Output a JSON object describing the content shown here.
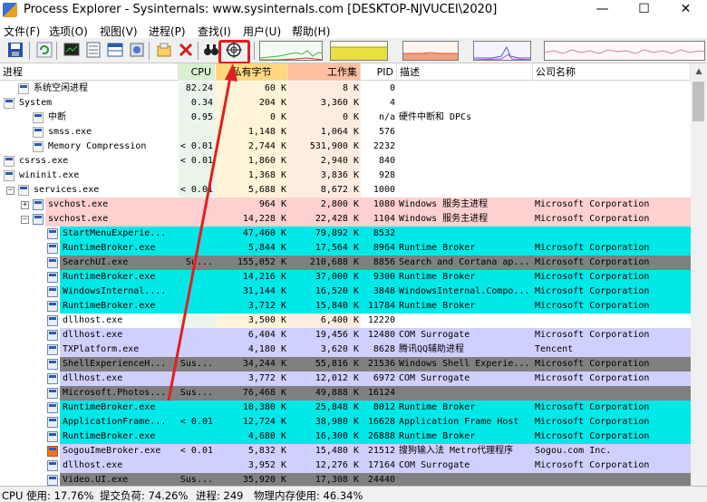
{
  "window": {
    "title": "Process Explorer - Sysinternals: www.sysinternals.com [DESKTOP-NJVUCEI\\2020]",
    "minimize_glyph": "—",
    "maximize_glyph": "☐",
    "close_glyph": "✕"
  },
  "menu": [
    "文件(F)",
    "选项(O)",
    "视图(V)",
    "进程(P)",
    "查找(I)",
    "用户(U)",
    "帮助(H)"
  ],
  "toolbar": {
    "icons": [
      "save-icon",
      "refresh-icon",
      "system-info-icon",
      "process-tree-icon",
      "lower-pane-icon",
      "handles-icon",
      "properties-icon",
      "kill-process-icon",
      "find-binoculars-icon",
      "target-crosshair-icon"
    ],
    "graph_colors": {
      "cpu": "#38b838",
      "commit": "#e8e020",
      "io": "#e05028",
      "net": "#4060e0",
      "mem": "#d8a0b0"
    }
  },
  "columns": {
    "process": "进程",
    "cpu": "CPU",
    "private": "私有字节",
    "working": "工作集",
    "pid": "PID",
    "desc": "描述",
    "company": "公司名称"
  },
  "colors": {
    "cyan": "#00e8e8",
    "pink": "#ffd0d0",
    "lavender": "#d0d0ff",
    "gray": "#808080",
    "cpu_bg": "#eaf6ea",
    "priv_bg": "#fff4d8",
    "ws_bg": "#ffece0",
    "priv_head": "#ffd880",
    "ws_head": "#ffc0a0",
    "cpu_head": "#d8f0d0"
  },
  "rows": [
    {
      "name": "系统空闲进程",
      "indent": 1,
      "exp": "",
      "icon": "none",
      "cpu": "82.24",
      "priv": "60 K",
      "ws": "8 K",
      "pid": "0",
      "desc": "",
      "company": "",
      "bg": ""
    },
    {
      "name": "System",
      "indent": 0,
      "exp": "−",
      "icon": "none",
      "cpu": "0.34",
      "priv": "204 K",
      "ws": "3,360 K",
      "pid": "4",
      "desc": "",
      "company": "",
      "bg": ""
    },
    {
      "name": "中断",
      "indent": 2,
      "exp": "",
      "icon": "none",
      "cpu": "0.95",
      "priv": "0 K",
      "ws": "0 K",
      "pid": "n/a",
      "desc": "硬件中断和 DPCs",
      "company": "",
      "bg": ""
    },
    {
      "name": "smss.exe",
      "indent": 2,
      "exp": "",
      "icon": "none",
      "cpu": "",
      "priv": "1,148 K",
      "ws": "1,064 K",
      "pid": "576",
      "desc": "",
      "company": "",
      "bg": ""
    },
    {
      "name": "Memory Compression",
      "indent": 2,
      "exp": "",
      "icon": "none",
      "cpu": "< 0.01",
      "priv": "2,744 K",
      "ws": "531,900 K",
      "pid": "2232",
      "desc": "",
      "company": "",
      "bg": ""
    },
    {
      "name": "csrss.exe",
      "indent": 0,
      "exp": "+",
      "icon": "none",
      "cpu": "< 0.01",
      "priv": "1,860 K",
      "ws": "2,940 K",
      "pid": "840",
      "desc": "",
      "company": "",
      "bg": ""
    },
    {
      "name": "wininit.exe",
      "indent": 0,
      "exp": "−",
      "icon": "none",
      "cpu": "",
      "priv": "1,368 K",
      "ws": "3,836 K",
      "pid": "928",
      "desc": "",
      "company": "",
      "bg": ""
    },
    {
      "name": "services.exe",
      "indent": 1,
      "exp": "−",
      "icon": "none",
      "cpu": "< 0.01",
      "priv": "5,688 K",
      "ws": "8,672 K",
      "pid": "1000",
      "desc": "",
      "company": "",
      "bg": ""
    },
    {
      "name": "svchost.exe",
      "indent": 2,
      "exp": "+",
      "icon": "win",
      "cpu": "",
      "priv": "964 K",
      "ws": "2,800 K",
      "pid": "1080",
      "desc": "Windows 服务主进程",
      "company": "Microsoft Corporation",
      "bg": "pink"
    },
    {
      "name": "svchost.exe",
      "indent": 2,
      "exp": "−",
      "icon": "win",
      "cpu": "",
      "priv": "14,228 K",
      "ws": "22,428 K",
      "pid": "1104",
      "desc": "Windows 服务主进程",
      "company": "Microsoft Corporation",
      "bg": "pink"
    },
    {
      "name": "StartMenuExperie...",
      "indent": 3,
      "exp": "",
      "icon": "win",
      "cpu": "",
      "priv": "47,460 K",
      "ws": "79,892 K",
      "pid": "8532",
      "desc": "",
      "company": "",
      "bg": "cyan"
    },
    {
      "name": "RuntimeBroker.exe",
      "indent": 3,
      "exp": "",
      "icon": "win",
      "cpu": "",
      "priv": "5,844 K",
      "ws": "17,564 K",
      "pid": "8964",
      "desc": "Runtime Broker",
      "company": "Microsoft Corporation",
      "bg": "cyan"
    },
    {
      "name": "SearchUI.exe",
      "indent": 3,
      "exp": "",
      "icon": "win",
      "cpu": "Su...",
      "priv": "155,052 K",
      "ws": "210,688 K",
      "pid": "8856",
      "desc": "Search and Cortana ap...",
      "company": "Microsoft Corporation",
      "bg": "gray"
    },
    {
      "name": "RuntimeBroker.exe",
      "indent": 3,
      "exp": "",
      "icon": "win",
      "cpu": "",
      "priv": "14,216 K",
      "ws": "37,000 K",
      "pid": "9300",
      "desc": "Runtime Broker",
      "company": "Microsoft Corporation",
      "bg": "cyan"
    },
    {
      "name": "WindowsInternal....",
      "indent": 3,
      "exp": "",
      "icon": "win",
      "cpu": "",
      "priv": "31,144 K",
      "ws": "16,520 K",
      "pid": "3848",
      "desc": "WindowsInternal.Compo...",
      "company": "Microsoft Corporation",
      "bg": "cyan"
    },
    {
      "name": "RuntimeBroker.exe",
      "indent": 3,
      "exp": "",
      "icon": "win",
      "cpu": "",
      "priv": "3,712 K",
      "ws": "15,840 K",
      "pid": "11784",
      "desc": "Runtime Broker",
      "company": "Microsoft Corporation",
      "bg": "cyan"
    },
    {
      "name": "dllhost.exe",
      "indent": 3,
      "exp": "",
      "icon": "win",
      "cpu": "",
      "priv": "3,500 K",
      "ws": "6,400 K",
      "pid": "12220",
      "desc": "",
      "company": "",
      "bg": ""
    },
    {
      "name": "dllhost.exe",
      "indent": 3,
      "exp": "",
      "icon": "win",
      "cpu": "",
      "priv": "6,404 K",
      "ws": "19,456 K",
      "pid": "12480",
      "desc": "COM Surrogate",
      "company": "Microsoft Corporation",
      "bg": "lavender"
    },
    {
      "name": "TXPlatform.exe",
      "indent": 3,
      "exp": "",
      "icon": "win",
      "cpu": "",
      "priv": "4,180 K",
      "ws": "3,620 K",
      "pid": "8628",
      "desc": "腾讯QQ辅助进程",
      "company": "Tencent",
      "bg": "lavender"
    },
    {
      "name": "ShellExperienceH...",
      "indent": 3,
      "exp": "",
      "icon": "win",
      "cpu": "Sus...",
      "priv": "34,244 K",
      "ws": "55,816 K",
      "pid": "21536",
      "desc": "Windows Shell Experie...",
      "company": "Microsoft Corporation",
      "bg": "gray"
    },
    {
      "name": "dllhost.exe",
      "indent": 3,
      "exp": "",
      "icon": "win",
      "cpu": "",
      "priv": "3,772 K",
      "ws": "12,012 K",
      "pid": "6972",
      "desc": "COM Surrogate",
      "company": "Microsoft Corporation",
      "bg": "lavender"
    },
    {
      "name": "Microsoft.Photos...",
      "indent": 3,
      "exp": "",
      "icon": "win",
      "cpu": "Sus...",
      "priv": "76,468 K",
      "ws": "49,888 K",
      "pid": "16124",
      "desc": "",
      "company": "",
      "bg": "gray"
    },
    {
      "name": "RuntimeBroker.exe",
      "indent": 3,
      "exp": "",
      "icon": "win",
      "cpu": "",
      "priv": "10,380 K",
      "ws": "25,848 K",
      "pid": "8012",
      "desc": "Runtime Broker",
      "company": "Microsoft Corporation",
      "bg": "cyan"
    },
    {
      "name": "ApplicationFrame...",
      "indent": 3,
      "exp": "",
      "icon": "win",
      "cpu": "< 0.01",
      "priv": "12,724 K",
      "ws": "38,980 K",
      "pid": "16628",
      "desc": "Application Frame Host",
      "company": "Microsoft Corporation",
      "bg": "cyan"
    },
    {
      "name": "RuntimeBroker.exe",
      "indent": 3,
      "exp": "",
      "icon": "win",
      "cpu": "",
      "priv": "4,680 K",
      "ws": "16,300 K",
      "pid": "26888",
      "desc": "Runtime Broker",
      "company": "Microsoft Corporation",
      "bg": "cyan"
    },
    {
      "name": "SogouImeBroker.exe",
      "indent": 3,
      "exp": "",
      "icon": "sogou",
      "cpu": "< 0.01",
      "priv": "5,832 K",
      "ws": "15,480 K",
      "pid": "21512",
      "desc": "搜狗输入法 Metro代理程序",
      "company": "Sogou.com Inc.",
      "bg": "lavender"
    },
    {
      "name": "dllhost.exe",
      "indent": 3,
      "exp": "",
      "icon": "win",
      "cpu": "",
      "priv": "3,952 K",
      "ws": "12,276 K",
      "pid": "17164",
      "desc": "COM Surrogate",
      "company": "Microsoft Corporation",
      "bg": "lavender"
    },
    {
      "name": "Video.UI.exe",
      "indent": 3,
      "exp": "",
      "icon": "win",
      "cpu": "Sus...",
      "priv": "35,920 K",
      "ws": "17,308 K",
      "pid": "24440",
      "desc": "",
      "company": "",
      "bg": "gray"
    }
  ],
  "status": {
    "cpu": "CPU 使用: 17.76%",
    "commit": "提交负荷: 74.26%",
    "procs": "进程: 249",
    "mem": "物理内存使用: 46.34%"
  }
}
